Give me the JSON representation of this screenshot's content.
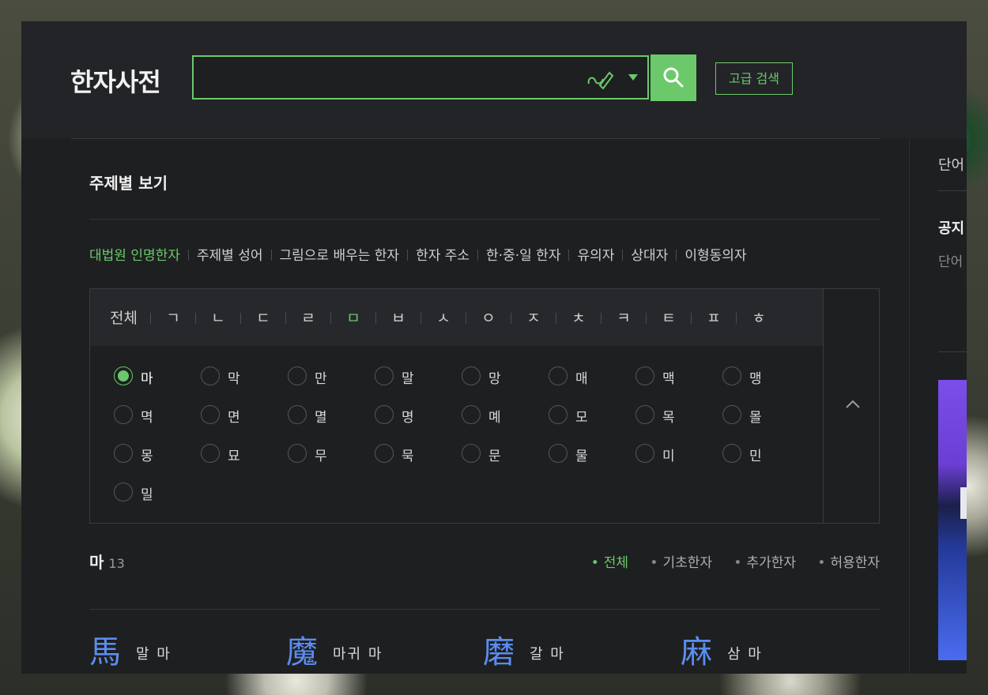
{
  "header": {
    "logo": "한자사전",
    "search": {
      "value": "",
      "placeholder": ""
    },
    "advanced_search_label": "고급 검색"
  },
  "main": {
    "section_title": "주제별 보기",
    "tabs": [
      {
        "label": "대법원 인명한자",
        "active": true
      },
      {
        "label": "주제별 성어",
        "active": false
      },
      {
        "label": "그림으로 배우는 한자",
        "active": false
      },
      {
        "label": "한자 주소",
        "active": false
      },
      {
        "label": "한·중·일 한자",
        "active": false
      },
      {
        "label": "유의자",
        "active": false
      },
      {
        "label": "상대자",
        "active": false
      },
      {
        "label": "이형동의자",
        "active": false
      }
    ],
    "consonants": [
      "전체",
      "ㄱ",
      "ㄴ",
      "ㄷ",
      "ㄹ",
      "ㅁ",
      "ㅂ",
      "ㅅ",
      "ㅇ",
      "ㅈ",
      "ㅊ",
      "ㅋ",
      "ㅌ",
      "ㅍ",
      "ㅎ"
    ],
    "active_consonant": "ㅁ",
    "syllables": [
      "마",
      "막",
      "만",
      "말",
      "망",
      "매",
      "맥",
      "맹",
      "멱",
      "면",
      "멸",
      "명",
      "몌",
      "모",
      "목",
      "몰",
      "몽",
      "묘",
      "무",
      "묵",
      "문",
      "물",
      "미",
      "민",
      "밀"
    ],
    "selected_syllable": "마",
    "result": {
      "name": "마",
      "count": "13",
      "filters": [
        {
          "label": "전체",
          "active": true
        },
        {
          "label": "기초한자",
          "active": false
        },
        {
          "label": "추가한자",
          "active": false
        },
        {
          "label": "허용한자",
          "active": false
        }
      ],
      "hanja": [
        {
          "char": "馬",
          "meaning": "말 마"
        },
        {
          "char": "魔",
          "meaning": "마귀 마"
        },
        {
          "char": "磨",
          "meaning": "갈 마"
        },
        {
          "char": "麻",
          "meaning": "삼 마"
        }
      ]
    }
  },
  "side": {
    "text1": "단어",
    "title": "공지",
    "text2": "단어"
  },
  "colors": {
    "accent": "#6bc96b",
    "hanja": "#5b8df0",
    "panel": "#1e1f21"
  },
  "icons": [
    "handwriting-pen-icon",
    "dropdown-arrow-icon",
    "search-icon",
    "chevron-up-icon"
  ]
}
